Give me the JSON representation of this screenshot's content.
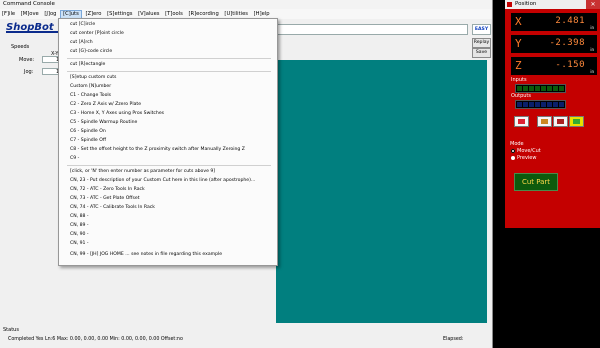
{
  "console": {
    "title": "Command Console",
    "menu": [
      "[F]ile",
      "[M]ove",
      "[J]og",
      "[C]uts",
      "[Z]ero",
      "[S]ettings",
      "[V]alues",
      "[T]ools",
      "[R]ecording",
      "[U]tilities",
      "[H]elp"
    ],
    "active_menu_index": 3,
    "logo_text": "ShopBot",
    "easy_label": "EASY",
    "replay_label": "Replay",
    "save_label": "Save",
    "speeds_title": "Speeds",
    "speeds_header": "X-Y",
    "move_label": "Move:",
    "move_value": "1",
    "jog_label": "Jog:",
    "jog_value": "1"
  },
  "cuts_menu": {
    "items": [
      "cut [C]ircle",
      "cut center [P]oint circle",
      "cut [A]rch",
      "cut [G]-code circle",
      "cut [R]ectangle",
      "[S]etup custom cuts",
      "Custom [N]umber",
      "C1  -  Change Tools",
      "C2  -  Zero Z Axis w/ Zzero Plate",
      "C3  -  Home X, Y Axes using Prox Switches",
      "C5  -  Spindle Warmup Routine",
      "C6  -  Spindle On",
      "C7  -  Spindle Off",
      "C8  -  Set the offset height to the Z proximity switch after Manually Zeroing Z",
      "C9  -",
      "[click, or 'N' then enter number as parameter for cuts above 9]",
      "CN, 23  -  Put description of your Custom Cut here in this line (after apostrophe)...",
      "CN, 72  -  ATC - Zero Tools In Rack",
      "CN, 73  -  ATC - Get Plate Offset",
      "CN, 74  -  ATC - Calibrate Tools In Rack",
      "CN, 88  -",
      "CN, 89  -",
      "CN, 90  -",
      "CN, 91  -",
      "CN, 99  -  [JH] JOG HOME ... see notes in file regarding this example"
    ]
  },
  "status": {
    "label": "Status",
    "text": "Completed Yes Ln:6 Max: 0.00, 0.00, 0.00   Min: 0.00, 0.00, 0.00   Offset:no",
    "elapsed_label": "Elapsed:"
  },
  "position": {
    "title": "Position",
    "close_label": "✕",
    "axes": [
      {
        "label": "X",
        "value": "2.481",
        "unit": "in"
      },
      {
        "label": "Y",
        "value": "-2.398",
        "unit": "in"
      },
      {
        "label": "Z",
        "value": "-.150",
        "unit": "in"
      }
    ],
    "inputs_label": "Inputs",
    "outputs_label": "Outputs",
    "mode_label": "Mode",
    "mode_options": [
      "Move/Cut",
      "Preview"
    ],
    "selected_mode": "Move/Cut",
    "cut_part_label": "Cut Part",
    "colors": {
      "panel": "#c40000",
      "display_text": "#ff8a3c",
      "input_led": "#0a5a0a",
      "output_led": "#0a1f6a",
      "preview_bg": "#017f7f"
    }
  }
}
